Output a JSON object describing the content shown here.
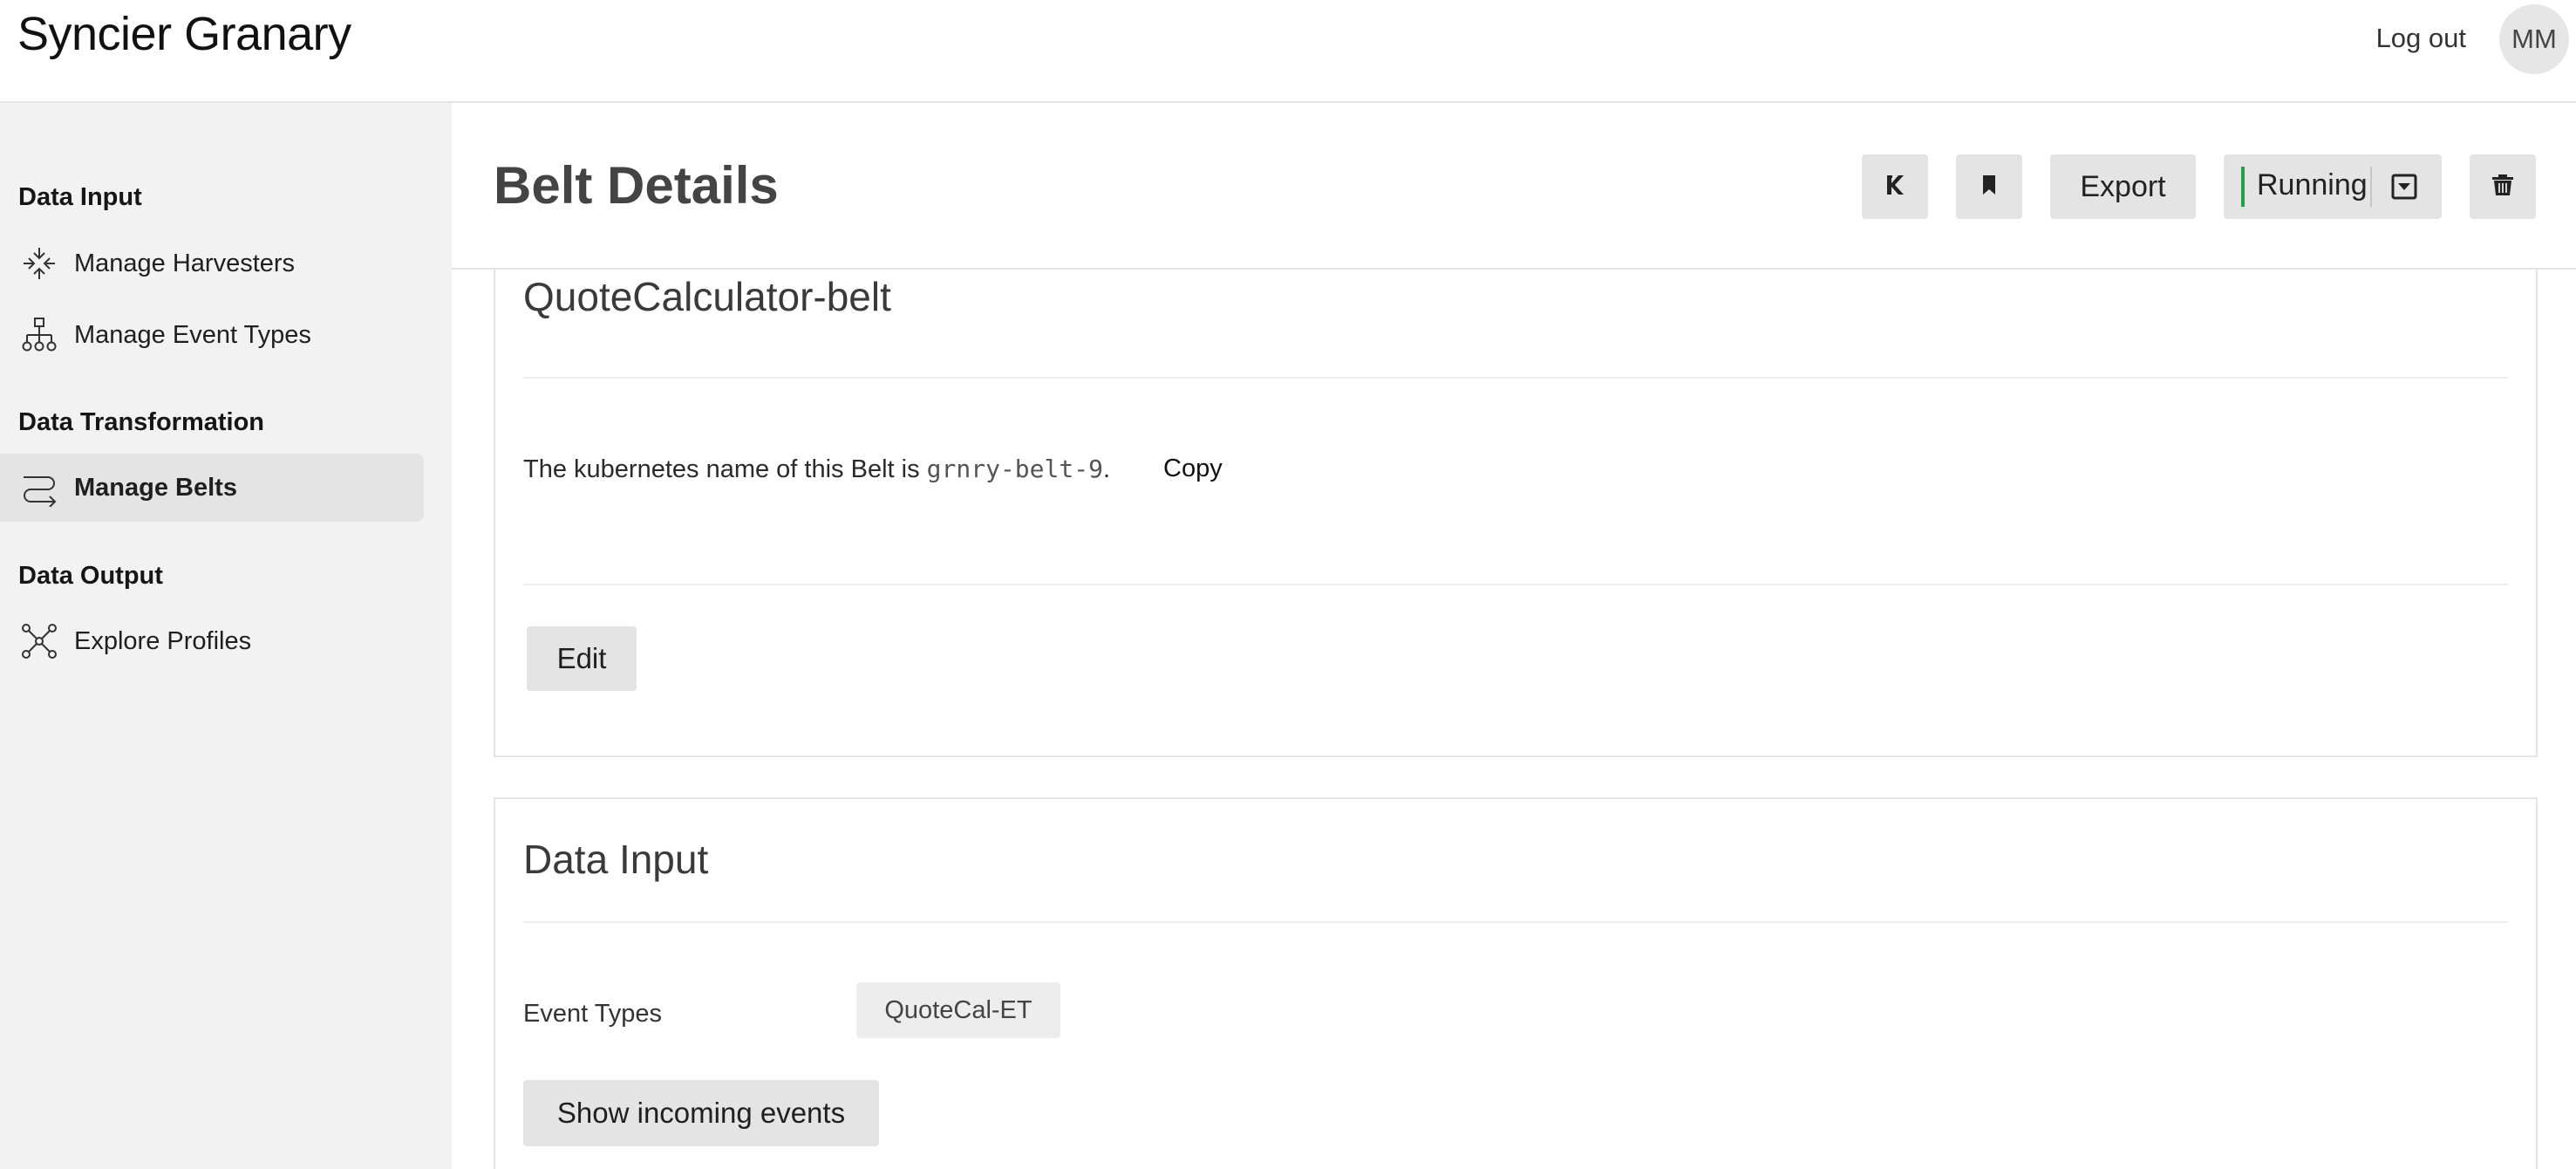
{
  "header": {
    "app_name": "Syncier Granary",
    "logout_label": "Log out",
    "avatar_initials": "MM"
  },
  "sidebar": {
    "sections": [
      {
        "title": "Data Input",
        "items": [
          {
            "label": "Manage Harvesters",
            "icon": "harvester-icon"
          },
          {
            "label": "Manage Event Types",
            "icon": "hierarchy-icon"
          }
        ]
      },
      {
        "title": "Data Transformation",
        "items": [
          {
            "label": "Manage Belts",
            "icon": "belt-icon",
            "active": true
          }
        ]
      },
      {
        "title": "Data Output",
        "items": [
          {
            "label": "Explore Profiles",
            "icon": "network-icon"
          }
        ]
      }
    ]
  },
  "page": {
    "title": "Belt Details",
    "toolbar": {
      "kafka_icon": "kafka-icon",
      "bookmark_icon": "bookmark-icon",
      "export_label": "Export",
      "status_label": "Running",
      "status_color": "#24a148",
      "dropdown_icon": "dropdown-icon",
      "delete_icon": "trash-icon"
    }
  },
  "belt_card": {
    "name": "QuoteCalculator-belt",
    "k8s_prefix": "The kubernetes name of this Belt is ",
    "k8s_name": "grnry-belt-9",
    "k8s_suffix": ".",
    "copy_label": "Copy",
    "edit_label": "Edit"
  },
  "data_input_card": {
    "title": "Data Input",
    "event_types_label": "Event Types",
    "event_types": [
      "QuoteCal-ET"
    ],
    "show_events_label": "Show incoming events"
  }
}
